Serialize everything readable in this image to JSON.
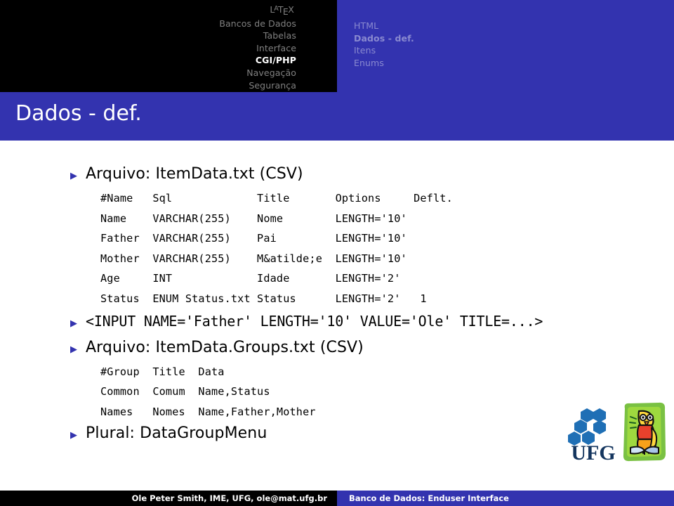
{
  "colors": {
    "brand_blue": "#3333AF",
    "nav_black": "#000000",
    "nav_inactive_grey": "#808080",
    "nav_inactive_blue": "#8a8ad0",
    "active_white": "#ffffff",
    "bullet_blue": "#3333AF"
  },
  "nav_left": {
    "logo": {
      "parts": [
        "L",
        "A",
        "T",
        "E",
        "X"
      ],
      "text": "LaTeX"
    },
    "items": [
      {
        "label": "Bancos de Dados",
        "active": false
      },
      {
        "label": "Tabelas",
        "active": false
      },
      {
        "label": "Interface",
        "active": false
      },
      {
        "label": "CGI/PHP",
        "active": true
      },
      {
        "label": "Navegação",
        "active": false
      },
      {
        "label": "Segurança",
        "active": false
      }
    ]
  },
  "nav_right": {
    "items": [
      {
        "label": "HTML",
        "active": false
      },
      {
        "label": "Dados - def.",
        "active": true
      },
      {
        "label": "Itens",
        "active": false
      },
      {
        "label": "Enums",
        "active": false
      }
    ]
  },
  "title": "Dados - def.",
  "bullet_glyph": "▶",
  "blocks": [
    {
      "bullet": "Arquivo: ItemData.txt (CSV)",
      "mono": false,
      "table": "#Name   Sql             Title       Options     Deflt.\nName    VARCHAR(255)    Nome        LENGTH='10'\nFather  VARCHAR(255)    Pai         LENGTH='10'\nMother  VARCHAR(255)    M&atilde;e  LENGTH='10'\nAge     INT             Idade       LENGTH='2'\nStatus  ENUM Status.txt Status      LENGTH='2'   1"
    },
    {
      "bullet": "<INPUT NAME='Father' LENGTH='10' VALUE='Ole' TITLE=...>",
      "mono": true,
      "table": ""
    },
    {
      "bullet": "Arquivo: ItemData.Groups.txt (CSV)",
      "mono": false,
      "table": "#Group  Title  Data\nCommon  Comum  Name,Status\nNames   Nomes  Name,Father,Mother"
    },
    {
      "bullet": "Plural: DataGroupMenu",
      "mono": false,
      "table": ""
    }
  ],
  "logos": {
    "ufg": {
      "name": "ufg-logo",
      "text": "UFG"
    },
    "owl": {
      "name": "owl-logo"
    }
  },
  "footer": {
    "left": "Ole Peter Smith, IME, UFG, ole@mat.ufg.br",
    "right": "Banco de Dados: Enduser Interface"
  }
}
